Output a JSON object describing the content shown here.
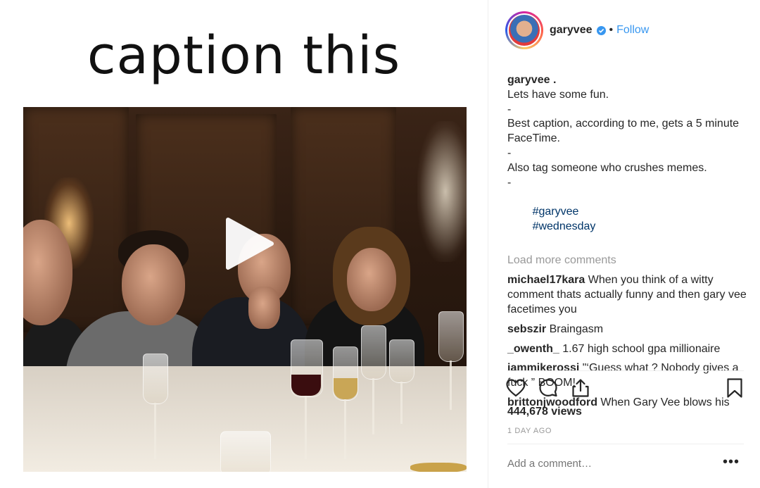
{
  "media": {
    "overlay_text": "caption this"
  },
  "post": {
    "author": "garyvee",
    "follow_label": "Follow",
    "separator": "•",
    "caption_lines": [
      {
        "text": "garyvee .",
        "type": "author"
      },
      {
        "text": "Lets have some fun.",
        "type": "text"
      },
      {
        "text": "-",
        "type": "text"
      },
      {
        "text": "Best caption, according to me, gets a 5 minute FaceTime.",
        "type": "text"
      },
      {
        "text": "-",
        "type": "text"
      },
      {
        "text": "Also tag someone who crushes memes.",
        "type": "text"
      },
      {
        "text": "-",
        "type": "text"
      }
    ],
    "hashtags": [
      "#garyvee",
      "#wednesday"
    ],
    "load_more_label": "Load more comments",
    "comments": [
      {
        "user": "michael17kara",
        "text": "When you think of a witty comment thats actually funny and then gary vee facetimes you"
      },
      {
        "user": "sebszir",
        "text": "Braingasm"
      },
      {
        "user": "_owenth_",
        "text": "1.67 high school gpa millionaire"
      },
      {
        "user": "iammikerossi",
        "text": "\"‘Guess what ? Nobody gives a fuck ” BOOM!"
      },
      {
        "user": "brittonjwoodford",
        "text": "When Gary Vee blows his"
      }
    ],
    "views": "444,678 views",
    "timestamp": "1 DAY AGO",
    "add_comment_placeholder": "Add a comment…",
    "more_label": "•••"
  },
  "icons": {
    "like": "heart-icon",
    "comment": "comment-icon",
    "share": "share-icon",
    "save": "bookmark-icon",
    "play": "play-icon",
    "verified": "verified-badge-icon"
  },
  "colors": {
    "link": "#3897f0",
    "hashtag": "#003569",
    "muted": "#999999",
    "text": "#262626"
  }
}
